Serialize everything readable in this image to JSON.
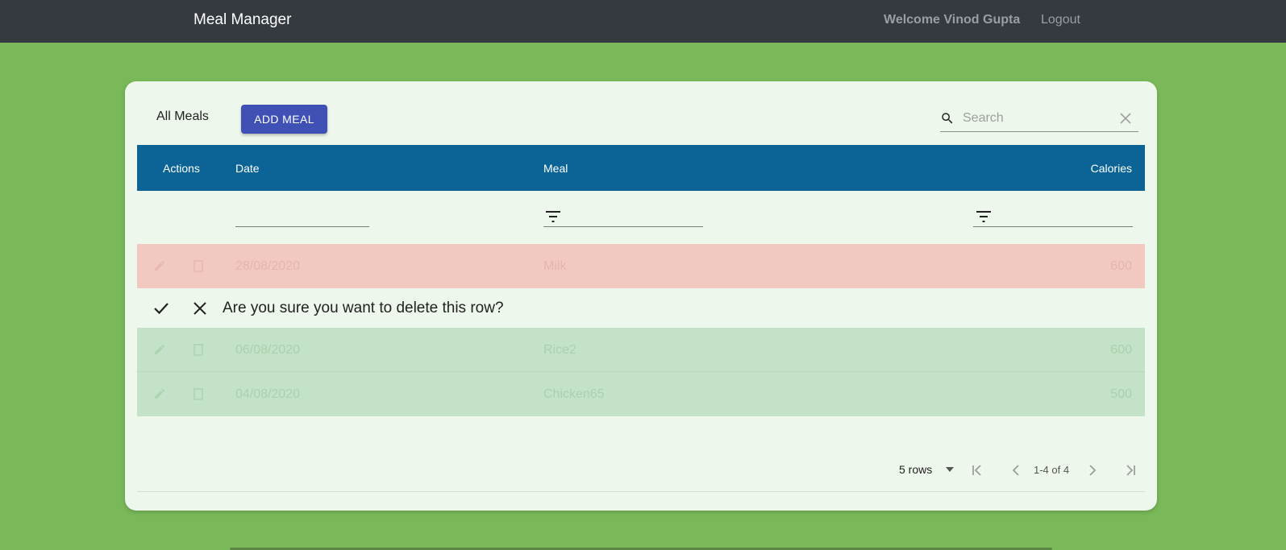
{
  "navbar": {
    "brand": "Meal Manager",
    "welcome": "Welcome Vinod Gupta",
    "logout": "Logout"
  },
  "toolbar": {
    "title": "All Meals",
    "add_label": "ADD MEAL",
    "search_placeholder": "Search",
    "search_value": ""
  },
  "table": {
    "columns": [
      "Actions",
      "Date",
      "Meal",
      "Calories"
    ],
    "rows": [
      {
        "date": "28/08/2020",
        "meal": "Milk",
        "calories": "600",
        "status": "over-limit"
      },
      {
        "date": "06/08/2020",
        "meal": "Rice2",
        "calories": "600",
        "status": "within-limit"
      },
      {
        "date": "04/08/2020",
        "meal": "Chicken65",
        "calories": "500",
        "status": "within-limit"
      }
    ],
    "confirm_delete": "Are you sure you want to delete this row?"
  },
  "pagination": {
    "rows_per_page": "5 rows",
    "range": "1-4 of 4"
  },
  "colors": {
    "background": "#7ab95a",
    "navbar": "#343a40",
    "header": "#0b6495",
    "add_button": "#3f51b5",
    "row_over": "#f2c9c1",
    "row_ok": "#c4e2c7"
  },
  "icons": [
    "search-icon",
    "clear-icon",
    "filter-icon",
    "edit-icon",
    "delete-icon",
    "check-icon",
    "close-icon",
    "first-page-icon",
    "previous-page-icon",
    "next-page-icon",
    "last-page-icon",
    "arrow-drop-down-icon"
  ]
}
